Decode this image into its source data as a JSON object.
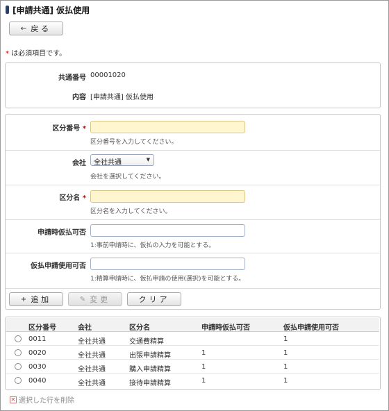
{
  "header": {
    "title": "[申請共通] 仮払使用",
    "back_label": "戻る",
    "back_icon": "arrow-left-icon"
  },
  "required_note": {
    "star": "*",
    "text": " は必須項目です。"
  },
  "info": {
    "common_no_label": "共通番号",
    "common_no_value": "00001020",
    "content_label": "内容",
    "content_value": "[申請共通] 仮払使用"
  },
  "form": {
    "division_no": {
      "label": "区分番号",
      "required_mark": "*",
      "value": "",
      "hint": "区分番号を入力してください。"
    },
    "company": {
      "label": "会社",
      "selected": "全社共通",
      "hint": "会社を選択してください。"
    },
    "division_name": {
      "label": "区分名",
      "required_mark": "*",
      "value": "",
      "hint": "区分名を入力してください。"
    },
    "apply_advance": {
      "label": "申請時仮払可否",
      "value": "",
      "hint": "1:事前申請時に、仮払の入力を可能とする。"
    },
    "advance_use": {
      "label": "仮払申請使用可否",
      "value": "",
      "hint": "1:精算申請時に、仮払申請の使用(選択)を可能とする。"
    }
  },
  "actions": {
    "add_label": "追加",
    "add_icon": "plus-icon",
    "update_label": "変更",
    "update_icon": "pencil-icon",
    "clear_label": "クリア"
  },
  "table": {
    "headers": [
      "区分番号",
      "会社",
      "区分名",
      "申請時仮払可否",
      "仮払申請使用可否"
    ],
    "rows": [
      [
        "0011",
        "全社共通",
        "交通費精算",
        "",
        "1"
      ],
      [
        "0020",
        "全社共通",
        "出張申請精算",
        "1",
        "1"
      ],
      [
        "0030",
        "全社共通",
        "購入申請精算",
        "1",
        "1"
      ],
      [
        "0040",
        "全社共通",
        "接待申請精算",
        "1",
        "1"
      ]
    ]
  },
  "delete_label": "選択した行を削除",
  "colors": {
    "required_bg": "#fff6cf",
    "required_star": "#d00000",
    "title_mark": "#2d3e63"
  }
}
